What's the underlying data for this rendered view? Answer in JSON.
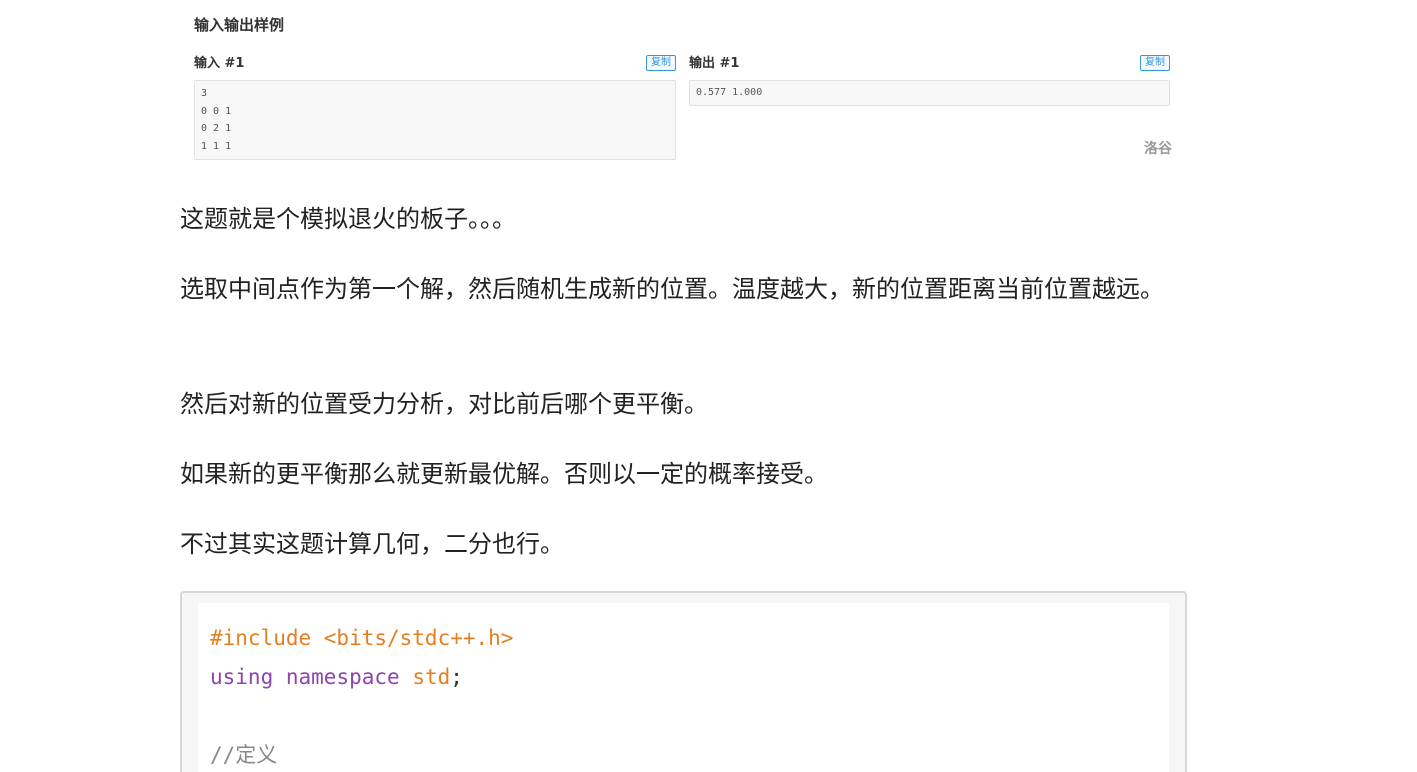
{
  "sample": {
    "heading": "输入输出样例",
    "input_title": "输入 #1",
    "output_title": "输出 #1",
    "copy_label": "复制",
    "input_text": "3\n0 0 1\n0 2 1\n1 1 1",
    "output_text": "0.577 1.000",
    "watermark": "洛谷"
  },
  "paragraphs": [
    "这题就是个模拟退火的板子。。。",
    "选取中间点作为第一个解，然后随机生成新的位置。温度越大，新的位置距离当前位置越远。",
    "然后对新的位置受力分析，对比前后哪个更平衡。",
    "如果新的更平衡那么就更新最优解。否则以一定的概率接受。",
    "不过其实这题计算几何，二分也行。"
  ],
  "code": {
    "include": "#include <bits/stdc++.h>",
    "using_kw": "using",
    "namespace_kw": "namespace",
    "std_id": "std",
    "semicolon": ";",
    "comment": "//定义"
  }
}
